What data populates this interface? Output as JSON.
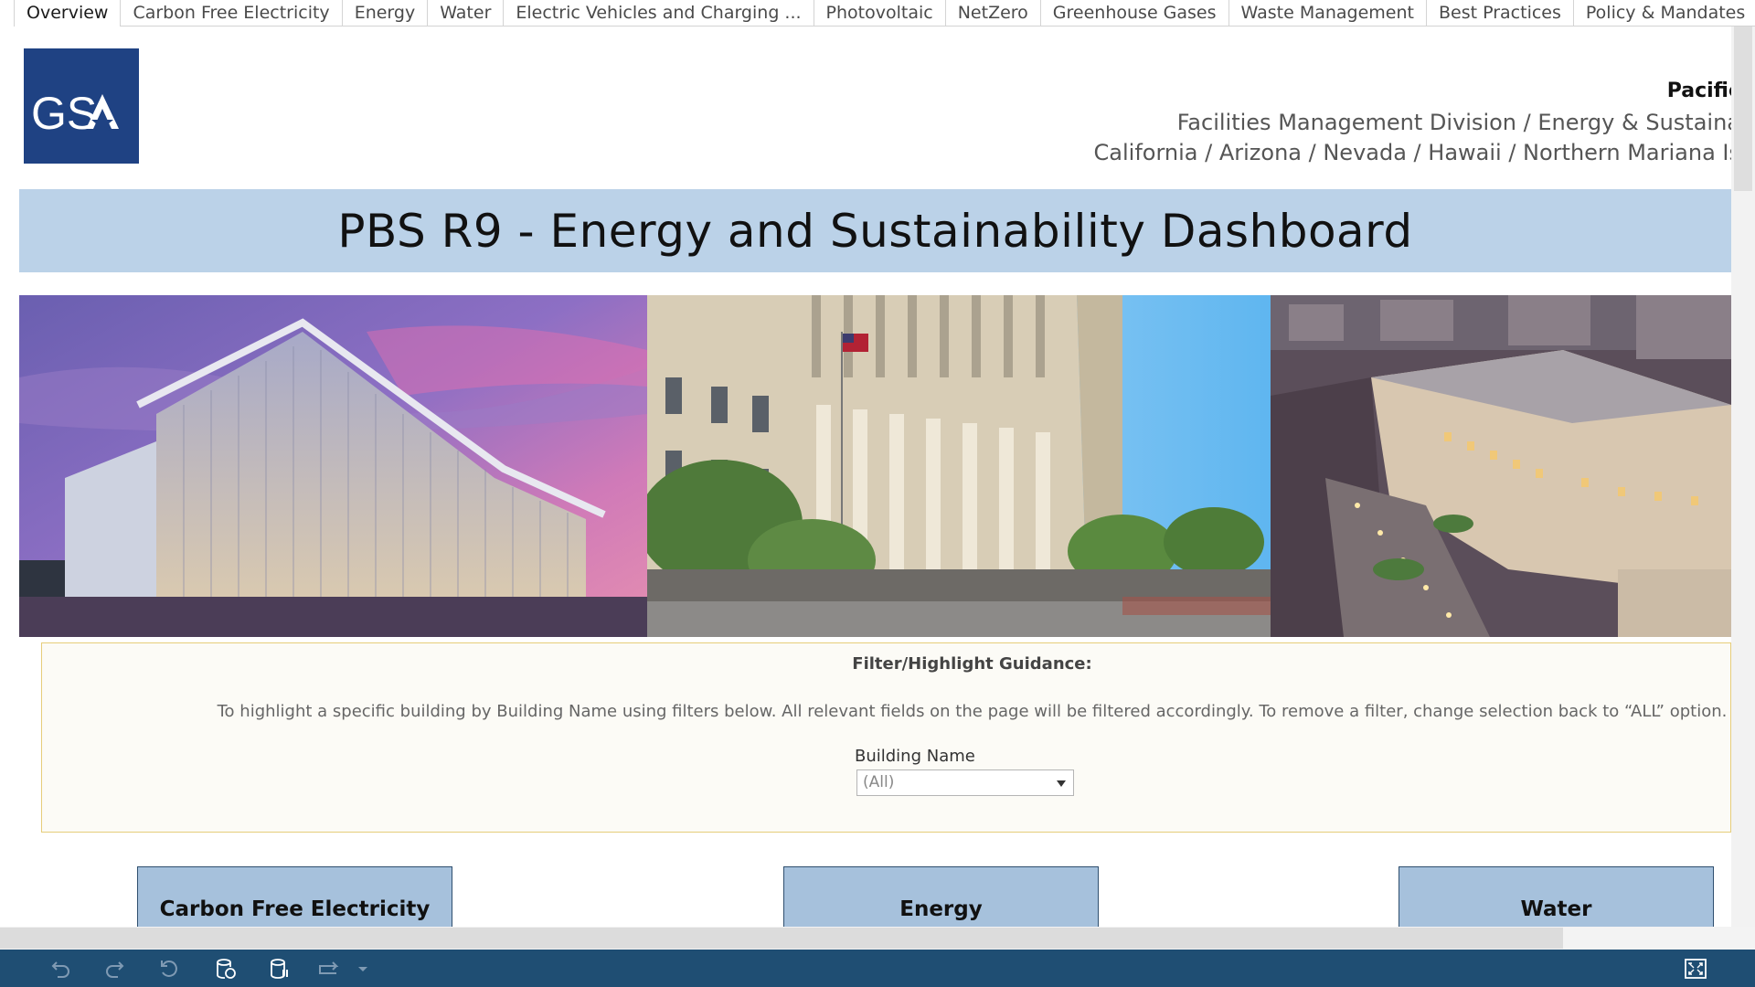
{
  "tabs": [
    {
      "label": "Overview",
      "active": true
    },
    {
      "label": "Carbon Free Electricity",
      "active": false
    },
    {
      "label": "Energy",
      "active": false
    },
    {
      "label": "Water",
      "active": false
    },
    {
      "label": "Electric Vehicles and Charging ...",
      "active": false
    },
    {
      "label": "Photovoltaic",
      "active": false
    },
    {
      "label": "NetZero",
      "active": false
    },
    {
      "label": "Greenhouse Gases",
      "active": false
    },
    {
      "label": "Waste Management",
      "active": false
    },
    {
      "label": "Best Practices",
      "active": false
    },
    {
      "label": "Policy & Mandates",
      "active": false
    }
  ],
  "header": {
    "logo_text": "GSA",
    "region": "Pacific",
    "division": "Facilities Management Division / Energy & Sustaina",
    "states": "California / Arizona / Nevada / Hawaii / Northern Mariana Is"
  },
  "title": "PBS R9 - Energy and Sustainability Dashboard",
  "photos": [
    {
      "name": "modern-glass-federal-building-photo"
    },
    {
      "name": "courthouse-with-flag-photo"
    },
    {
      "name": "aerial-civic-center-photo"
    }
  ],
  "guidance": {
    "title": "Filter/Highlight Guidance:",
    "text": "To highlight a specific building by Building Name using filters below. All relevant fields on the page will be filtered accordingly. To remove a filter, change selection back to “ALL” option.",
    "filter_label": "Building Name",
    "filter_value": "(All)"
  },
  "cards": [
    {
      "label": "Carbon Free Electricity"
    },
    {
      "label": "Energy"
    },
    {
      "label": "Water"
    }
  ],
  "toolbar": {
    "icons": [
      "undo-icon",
      "redo-icon",
      "revert-icon",
      "refresh-data-icon",
      "pause-updates-icon",
      "share-icon",
      "share-dropdown-icon",
      "fullscreen-icon"
    ]
  },
  "colors": {
    "toolbar_bg": "#1f4e73",
    "title_band": "#bbd2e8",
    "card_bg": "#a6c1dc",
    "logo_bg": "#1f4283",
    "guide_border": "#e6cd7a"
  }
}
